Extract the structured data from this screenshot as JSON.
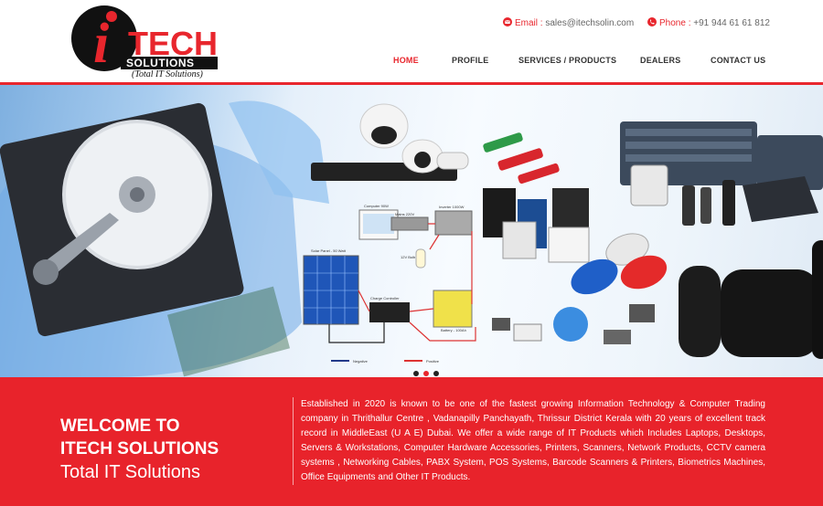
{
  "brand": {
    "logo_letter": "i",
    "logo_word": "TECH",
    "logo_sub": "SOLUTIONS",
    "tagline": "(Total IT Solutions)",
    "colors": {
      "red": "#e8262d",
      "black": "#111111"
    }
  },
  "contact": {
    "email_label": "Email :",
    "email_value": "sales@itechsolin.com",
    "email_icon": "mail-icon",
    "phone_label": "Phone :",
    "phone_value": "+91 944 61 61 812",
    "phone_icon": "phone-icon"
  },
  "nav": {
    "items": [
      {
        "label": "HOME",
        "active": true
      },
      {
        "label": "PROFILE",
        "active": false
      },
      {
        "label": "SERVICES / PRODUCTS",
        "active": false
      },
      {
        "label": "DEALERS",
        "active": false
      },
      {
        "label": "CONTACT US",
        "active": false
      }
    ]
  },
  "banner": {
    "slides": 3,
    "active_slide": 2,
    "diagram_labels": {
      "computer": "Computer 90W",
      "inverter": "Inverter 1000W",
      "mains": "Mains 220V",
      "solar": "Solar Panel - 50 Watt",
      "bulb": "12V Bulb",
      "controller": "Charge Controller",
      "battery": "Battery - 100Ah",
      "negative": "Negative",
      "positive": "Positive"
    }
  },
  "welcome": {
    "heading_line1": "WELCOME TO",
    "heading_line2": "ITECH SOLUTIONS",
    "subheading": "Total IT Solutions",
    "about": "Established in 2020 is known to be one of the fastest growing Information Technology & Computer Trading company in Thrithallur Centre , Vadanapilly Panchayath, Thrissur District Kerala with 20 years of excellent track record in MiddleEast (U A E) Dubai. We offer a wide range of IT Products which Includes Laptops, Desktops, Servers & Workstations, Computer Hardware Accessories, Printers, Scanners, Network Products, CCTV camera systems , Networking Cables, PABX System, POS Systems, Barcode Scanners & Printers, Biometrics Machines, Office Equipments and Other IT Products."
  }
}
